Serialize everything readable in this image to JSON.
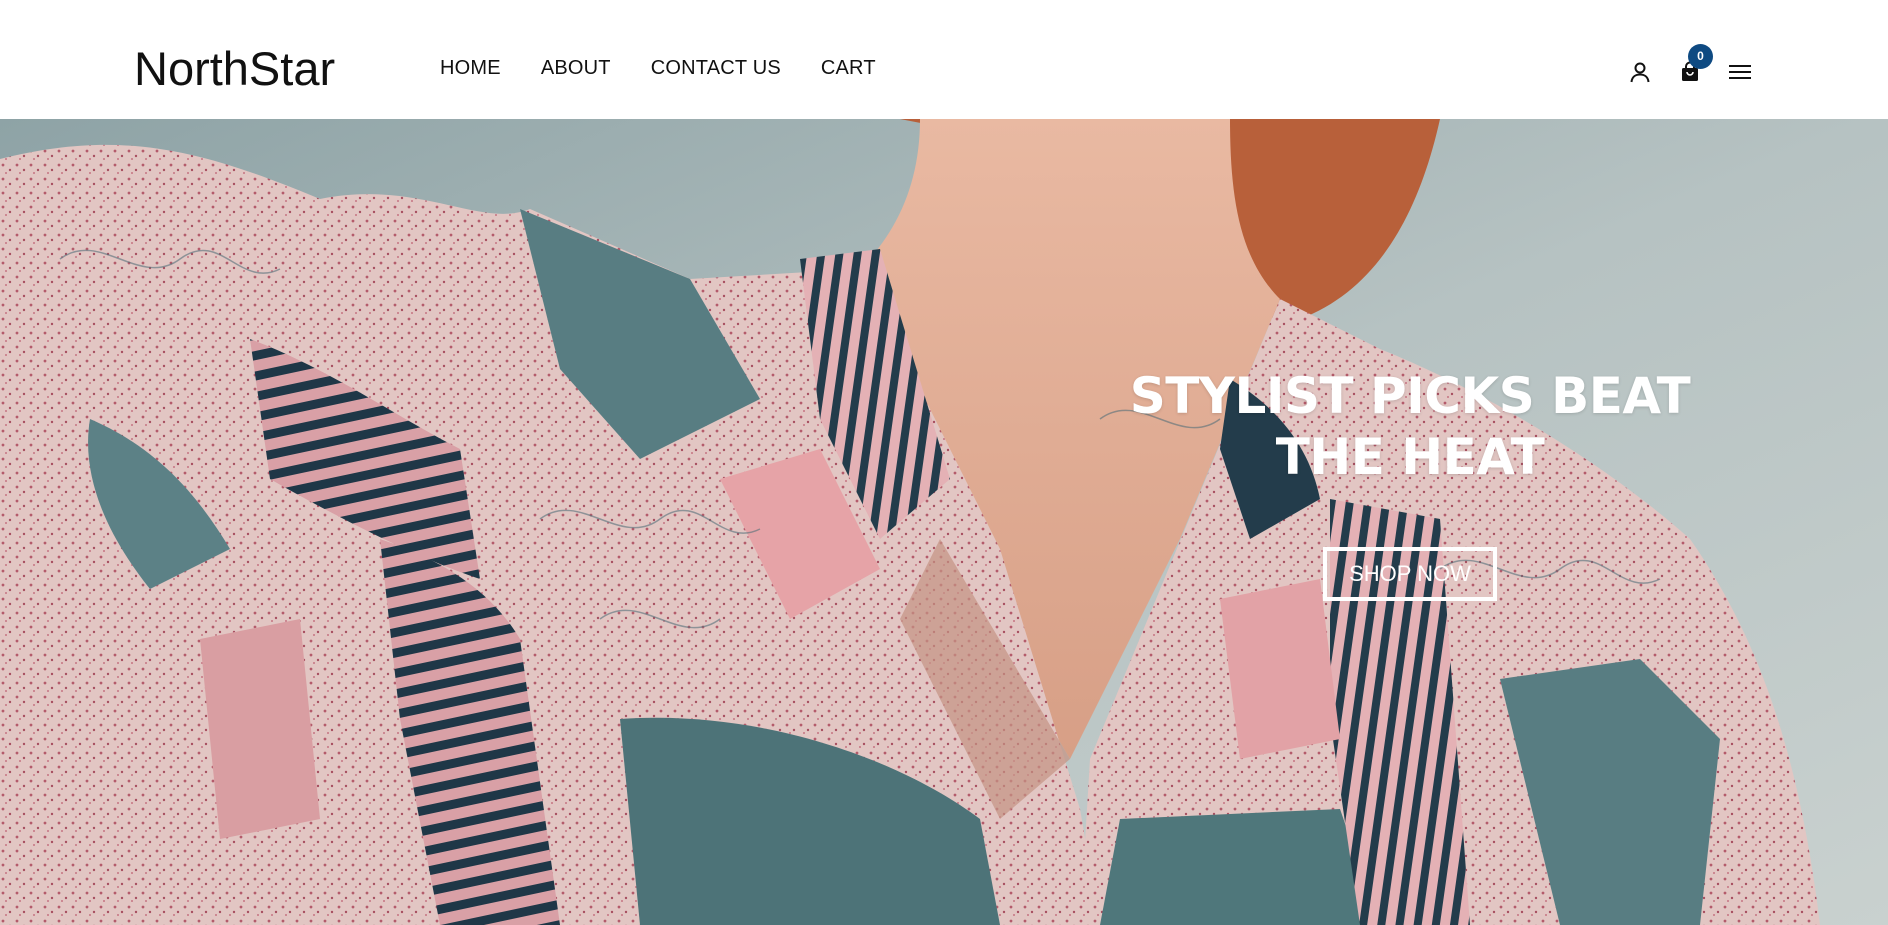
{
  "brand": {
    "name": "NorthStar"
  },
  "nav": {
    "items": [
      {
        "label": "HOME"
      },
      {
        "label": "ABOUT"
      },
      {
        "label": "CONTACT US"
      },
      {
        "label": "CART"
      }
    ]
  },
  "header_icons": {
    "user": "user-icon",
    "cart": "shopping-bag-icon",
    "cart_count": "0",
    "menu": "hamburger-menu-icon"
  },
  "hero": {
    "title_line1": "STYLIST PICKS BEAT",
    "title_line2": "THE HEAT",
    "cta_label": "SHOP NOW",
    "image": "woman-in-patterned-shirt-photo"
  },
  "colors": {
    "badge": "#0e4a82",
    "text": "#111111",
    "hero_text": "#ffffff"
  }
}
